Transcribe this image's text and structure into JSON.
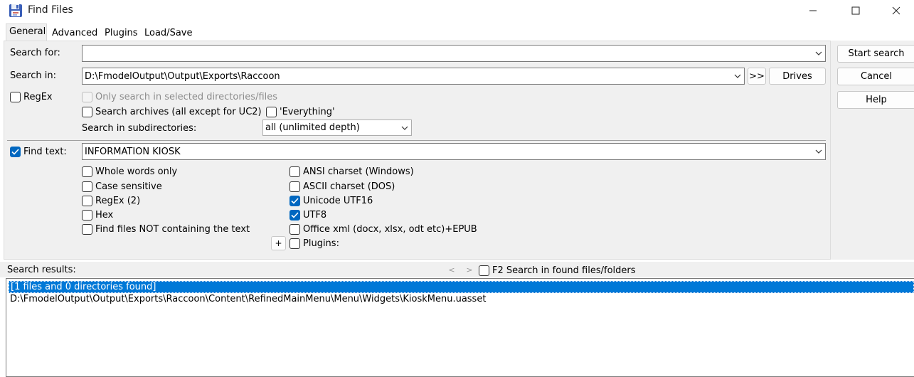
{
  "window": {
    "title": "Find Files",
    "icon": "floppy-search-icon"
  },
  "tabs": [
    {
      "label": "General",
      "active": true
    },
    {
      "label": "Advanced",
      "active": false
    },
    {
      "label": "Plugins",
      "active": false
    },
    {
      "label": "Load/Save",
      "active": false
    }
  ],
  "search": {
    "search_for_label": "Search for:",
    "search_for_value": "",
    "search_in_label": "Search in:",
    "search_in_value": "D:\\FmodelOutput\\Output\\Exports\\Raccoon",
    "browse_label": ">>",
    "drives_label": "Drives",
    "regex_label": "RegEx",
    "only_selected_label": "Only search in selected directories/files",
    "archives_label": "Search archives (all except for UC2)",
    "everything_label": "'Everything'",
    "subdirs_label": "Search in subdirectories:",
    "subdirs_value": "all (unlimited depth)"
  },
  "find_text": {
    "label": "Find text:",
    "checked": true,
    "value": "INFORMATION KIOSK",
    "options_left": [
      {
        "label": "Whole words only",
        "checked": false
      },
      {
        "label": "Case sensitive",
        "checked": false
      },
      {
        "label": "RegEx (2)",
        "checked": false
      },
      {
        "label": "Hex",
        "checked": false
      },
      {
        "label": "Find files NOT containing the text",
        "checked": false
      }
    ],
    "options_right": [
      {
        "label": "ANSI charset (Windows)",
        "checked": false
      },
      {
        "label": "ASCII charset (DOS)",
        "checked": false
      },
      {
        "label": "Unicode UTF16",
        "checked": true
      },
      {
        "label": "UTF8",
        "checked": true
      },
      {
        "label": "Office xml (docx, xlsx, odt etc)+EPUB",
        "checked": false
      },
      {
        "label": "Plugins:",
        "checked": false
      }
    ],
    "plus_label": "+"
  },
  "actions": {
    "start_label": "Start search",
    "cancel_label": "Cancel",
    "help_label": "Help"
  },
  "results": {
    "label": "Search results:",
    "prev_label": "<",
    "next_label": ">",
    "f2_label": "F2 Search in found files/folders",
    "items": [
      "[1 files and 0 directories found]",
      "D:\\FmodelOutput\\Output\\Exports\\Raccoon\\Content\\RefinedMainMenu\\Menu\\Widgets\\KioskMenu.uasset"
    ]
  },
  "colors": {
    "accent": "#0067c0",
    "selection": "#0078d7",
    "panel": "#f0f0f0"
  }
}
